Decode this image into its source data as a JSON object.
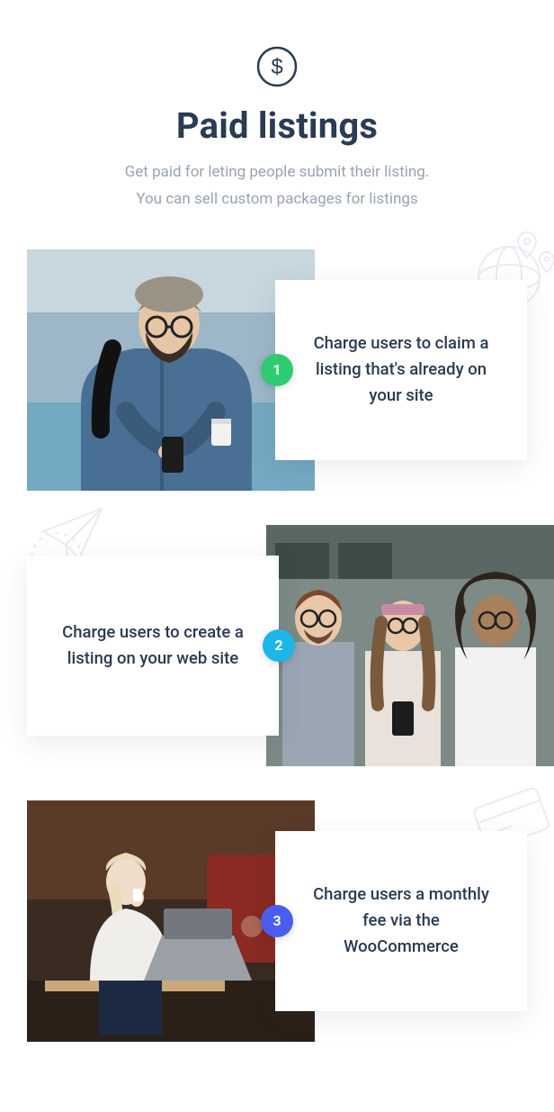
{
  "header": {
    "icon": "dollar-circle-icon",
    "title": "Paid listings",
    "subtitle_line1": "Get paid for leting people submit their listing.",
    "subtitle_line2": "You can sell custom packages for listings"
  },
  "colors": {
    "badge1": "#2ecc71",
    "badge2": "#1db6e8",
    "badge3": "#4a5df0",
    "heading": "#2a3b52",
    "muted": "#99a3af"
  },
  "steps": [
    {
      "num": "1",
      "text": "Charge users to claim a listing that's already on your site",
      "badge_color": "#2ecc71",
      "image_alt": "man-with-phone-and-coffee"
    },
    {
      "num": "2",
      "text": "Charge users to create a listing on your web site",
      "badge_color": "#1db6e8",
      "image_alt": "three-friends-looking-at-phone"
    },
    {
      "num": "3",
      "text": "Charge users a monthly fee via the WooCommerce",
      "badge_color": "#4a5df0",
      "image_alt": "woman-with-laptop-in-cafe"
    }
  ]
}
